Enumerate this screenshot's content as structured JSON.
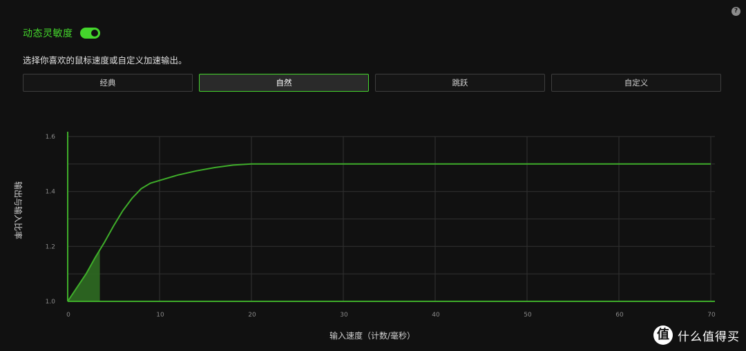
{
  "help_icon": {
    "glyph": "?",
    "icon": "help-icon"
  },
  "header": {
    "title": "动态灵敏度",
    "toggle_on": true
  },
  "description": "选择你喜欢的鼠标速度或自定义加速输出。",
  "presets": [
    {
      "label": "经典",
      "active": false
    },
    {
      "label": "自然",
      "active": true
    },
    {
      "label": "跳跃",
      "active": false
    },
    {
      "label": "自定义",
      "active": false
    }
  ],
  "colors": {
    "accent": "#44d62c",
    "curve": "#3fae2a",
    "grid": "#2e2e2e",
    "background": "#111111"
  },
  "chart_data": {
    "type": "line",
    "xlabel": "输入速度（计数/毫秒）",
    "ylabel": "输出与输入比率",
    "xlim": [
      0,
      70
    ],
    "ylim": [
      1.0,
      1.6
    ],
    "x_ticks": [
      "0",
      "10",
      "20",
      "30",
      "40",
      "50",
      "60",
      "70"
    ],
    "y_ticks": [
      "1.0",
      "1.2",
      "1.4",
      "1.6"
    ],
    "grid": true,
    "series": [
      {
        "points": [
          [
            0,
            1.0
          ],
          [
            1,
            1.05
          ],
          [
            2,
            1.1
          ],
          [
            3,
            1.16
          ],
          [
            4,
            1.215
          ],
          [
            5,
            1.275
          ],
          [
            6,
            1.33
          ],
          [
            7,
            1.375
          ],
          [
            8,
            1.41
          ],
          [
            9,
            1.43
          ],
          [
            10,
            1.44
          ],
          [
            12,
            1.46
          ],
          [
            14,
            1.475
          ],
          [
            16,
            1.487
          ],
          [
            18,
            1.496
          ],
          [
            20,
            1.5
          ],
          [
            30,
            1.5
          ],
          [
            40,
            1.5
          ],
          [
            50,
            1.5
          ],
          [
            60,
            1.5
          ],
          [
            70,
            1.5
          ]
        ]
      }
    ],
    "highlight": {
      "x_start": 0,
      "x_end": 3.5
    }
  },
  "watermark": {
    "logo_glyph": "值",
    "text": "什么值得买"
  }
}
